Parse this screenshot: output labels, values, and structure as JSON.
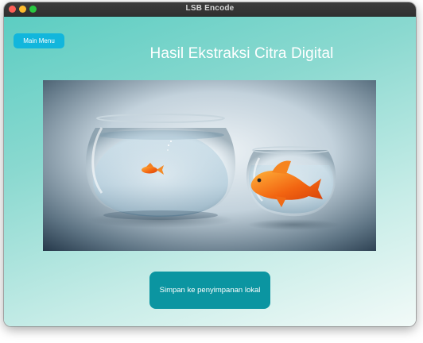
{
  "window": {
    "title": "LSB Encode"
  },
  "nav": {
    "main_menu_label": "Main Menu"
  },
  "header": {
    "title": "Hasil Ekstraksi Citra Digital"
  },
  "actions": {
    "save_label": "Simpan ke penyimpanan lokal"
  },
  "colors": {
    "menu_button": "#12b6dc",
    "save_button": "#0b95a1",
    "background_start": "#5ccdc2",
    "background_end": "#f2faf8"
  }
}
